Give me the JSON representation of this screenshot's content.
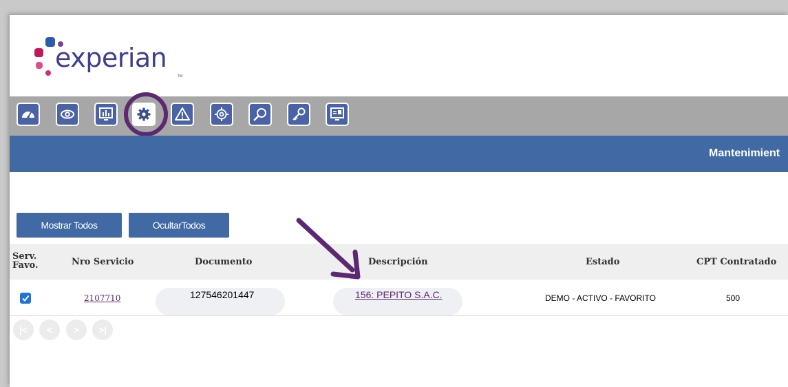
{
  "logo": {
    "text": "experian",
    "tm": "TM"
  },
  "toolbar": {
    "icons": [
      "speedometer-icon",
      "eye-icon",
      "bar-chart-icon",
      "gear-icon",
      "warning-icon",
      "gear-badge-icon",
      "magnifier-icon",
      "key-icon",
      "monitor-chart-icon"
    ],
    "active_index": 3
  },
  "header": {
    "title": "Mantenimient"
  },
  "actions": {
    "show_all": "Mostrar Todos",
    "hide_all": "OcultarTodos"
  },
  "table": {
    "columns": {
      "fav_line1": "Serv.",
      "fav_line2": "Favo.",
      "nro_servicio": "Nro Servicio",
      "documento": "Documento",
      "descripcion": "Descripción",
      "estado": "Estado",
      "cpt": "CPT Contratado"
    },
    "rows": [
      {
        "favorite": true,
        "nro_servicio": "2107710",
        "documento": "127546201447",
        "descripcion": "156: PEPITO S.A.C.",
        "estado": "DEMO - ACTIVO - FAVORITO",
        "cpt": "500"
      }
    ]
  },
  "pager": {
    "first": "|<",
    "prev": "<",
    "next": ">",
    "last": ">|"
  },
  "colors": {
    "brand_blue": "#4169a3",
    "highlight_purple": "#5c2970",
    "toolbar_gray": "#a7a7a7"
  }
}
